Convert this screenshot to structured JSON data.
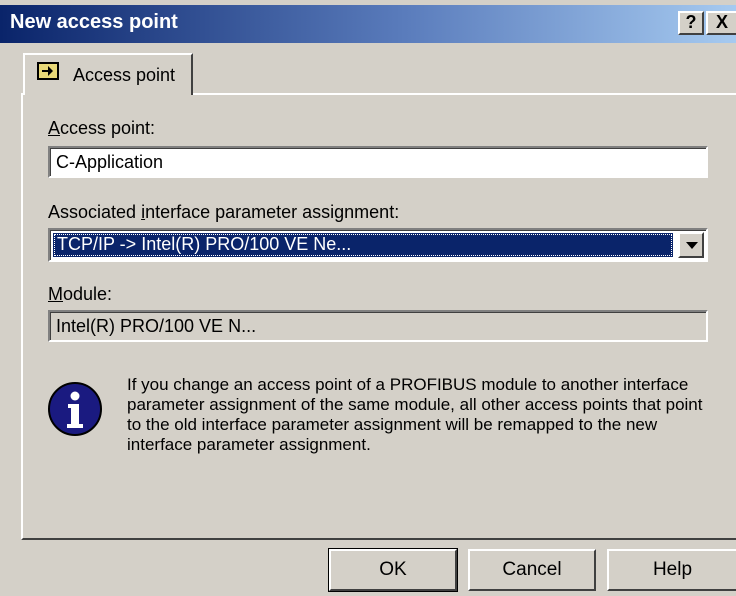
{
  "window": {
    "title": "New access point",
    "help_glyph": "?",
    "close_glyph": "X"
  },
  "tab": {
    "label": "Access point",
    "icon": "access-point-icon"
  },
  "form": {
    "access_point_label_accel": "A",
    "access_point_label_rest": "ccess point:",
    "access_point_value": "C-Application",
    "assignment_label_pre": "Associated ",
    "assignment_label_accel": "i",
    "assignment_label_post": "nterface parameter assignment:",
    "assignment_value": "TCP/IP -> Intel(R) PRO/100 VE Ne...",
    "module_label_accel": "M",
    "module_label_rest": "odule:",
    "module_value": "Intel(R) PRO/100 VE N..."
  },
  "info": {
    "icon": "info-icon",
    "text": "If you change an access point of a PROFIBUS module to another interface parameter assignment of the same module, all other access points that point to the old interface parameter assignment will be remapped to the new interface parameter assignment."
  },
  "buttons": {
    "ok": "OK",
    "cancel": "Cancel",
    "help": "Help"
  },
  "colors": {
    "title_bar": "#0a246a",
    "selection": "#0a246a",
    "dialog_face": "#d4d0c8"
  }
}
